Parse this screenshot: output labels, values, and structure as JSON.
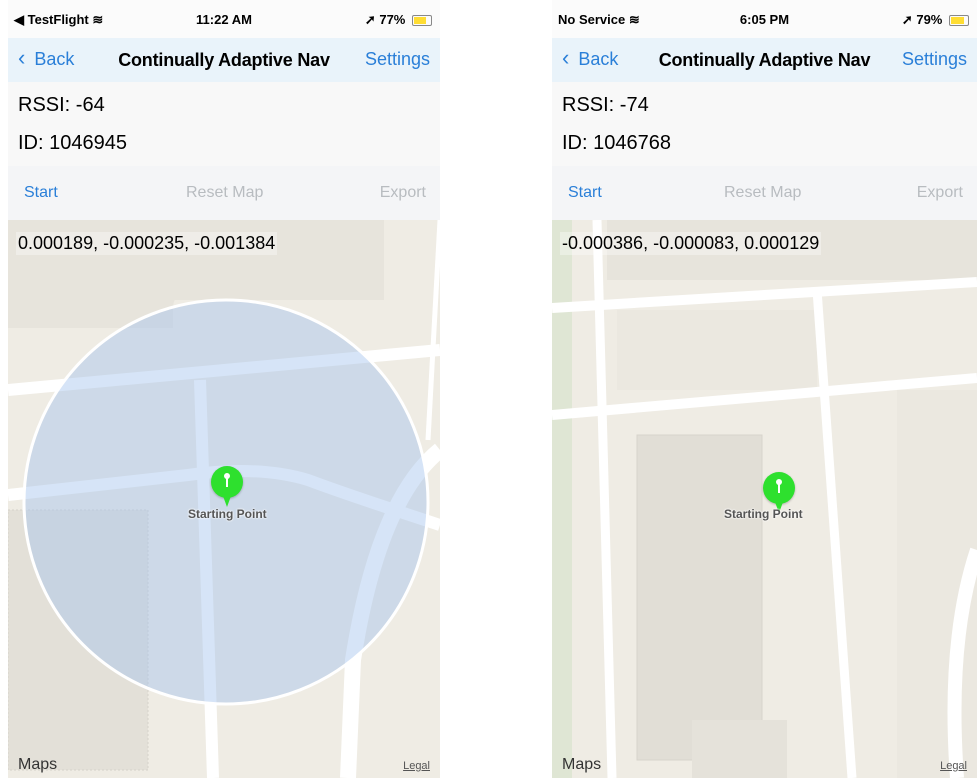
{
  "screens": [
    {
      "status": {
        "left": "◀ TestFlight",
        "time": "11:22 AM",
        "battery": "77%",
        "battery_level": 0.77
      },
      "nav": {
        "back": "Back",
        "title": "Continually Adaptive Nav",
        "settings": "Settings"
      },
      "info": {
        "rssi": "RSSI: -64",
        "id": "ID: 1046945"
      },
      "toolbar": {
        "start": "Start",
        "reset": "Reset Map",
        "export": "Export"
      },
      "map": {
        "coords": "0.000189, -0.000235, -0.001384",
        "pin_label": "Starting Point",
        "maps": "Maps",
        "legal": "Legal"
      },
      "colors": {
        "accent": "#2a7fd8",
        "pin": "#2ee02e",
        "nav_bg": "#e9f3fa",
        "disabled": "#b8bcc0"
      }
    },
    {
      "status": {
        "left": "No Service",
        "time": "6:05 PM",
        "battery": "79%",
        "battery_level": 0.79
      },
      "nav": {
        "back": "Back",
        "title": "Continually Adaptive Nav",
        "settings": "Settings"
      },
      "info": {
        "rssi": "RSSI: -74",
        "id": "ID: 1046768"
      },
      "toolbar": {
        "start": "Start",
        "reset": "Reset Map",
        "export": "Export"
      },
      "map": {
        "coords": "-0.000386, -0.000083, 0.000129",
        "pin_label": "Starting Point",
        "maps": "Maps",
        "legal": "Legal"
      },
      "colors": {
        "accent": "#2a7fd8",
        "pin": "#2ee02e",
        "nav_bg": "#e9f3fa",
        "disabled": "#b8bcc0"
      }
    }
  ],
  "icons": [
    "wifi-icon",
    "location-arrow-icon",
    "battery-icon",
    "chevron-left-icon",
    "map-pin-icon",
    "apple-logo-icon"
  ]
}
